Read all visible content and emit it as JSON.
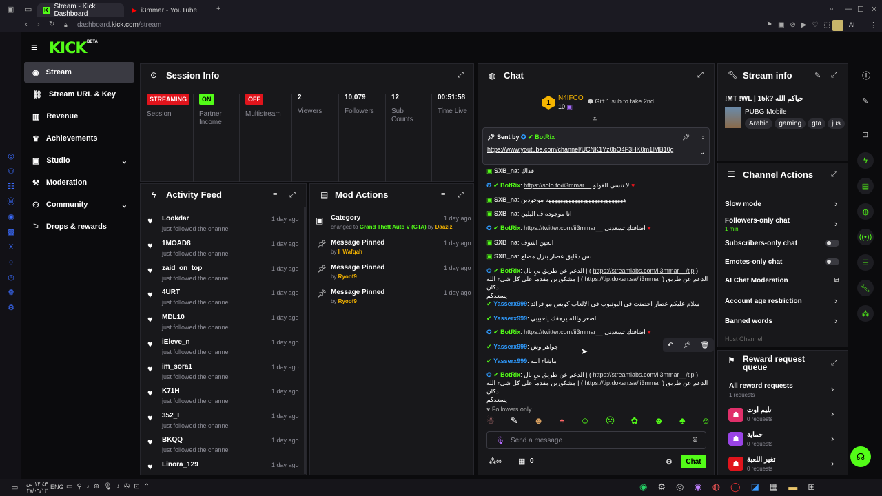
{
  "browser": {
    "tabs": [
      {
        "title": "Stream - Kick Dashboard",
        "active": true
      },
      {
        "title": "i3mmar - YouTube",
        "active": false
      }
    ],
    "url_prefix": "dashboard.",
    "url_main": "kick.com",
    "url_path": "/stream",
    "ai_label": "AI"
  },
  "brand": {
    "logo": "KICK",
    "beta": "BETA",
    "accent": "#53fc18"
  },
  "sidebar": {
    "items": [
      {
        "label": "Stream",
        "icon": "stream-icon",
        "active": true
      },
      {
        "label": "Stream URL & Key",
        "icon": "link-icon"
      },
      {
        "label": "Revenue",
        "icon": "chart-icon"
      },
      {
        "label": "Achievements",
        "icon": "trophy-icon"
      },
      {
        "label": "Studio",
        "icon": "video-icon",
        "expandable": true
      },
      {
        "label": "Moderation",
        "icon": "hammer-icon"
      },
      {
        "label": "Community",
        "icon": "users-icon",
        "expandable": true
      },
      {
        "label": "Drops & rewards",
        "icon": "gift-icon"
      }
    ]
  },
  "session": {
    "title": "Session Info",
    "stats": [
      {
        "badge": "STREAMING",
        "badge_color": "#e0141c",
        "label": "Session"
      },
      {
        "badge": "ON",
        "badge_color": "#53fc18",
        "label": "Partner Income"
      },
      {
        "badge": "OFF",
        "badge_color": "#e0141c",
        "label": "Multistream"
      },
      {
        "value": "2",
        "label": "Viewers"
      },
      {
        "value": "10,079",
        "label": "Followers"
      },
      {
        "value": "12",
        "label": "Sub Counts"
      },
      {
        "value": "00:51:58",
        "label": "Time Live"
      }
    ]
  },
  "activity": {
    "title": "Activity Feed",
    "subtitle": "just followed the channel",
    "time": "1 day ago",
    "items": [
      "Lookdar",
      "1MOAD8",
      "zaid_on_top",
      "4URT",
      "MDL10",
      "iEleve_n",
      "im_sora1",
      "K71H",
      "352_I",
      "BKQQ",
      "Linora_129"
    ]
  },
  "mod_actions": {
    "title": "Mod Actions",
    "time": "1 day ago",
    "items": [
      {
        "title": "Category",
        "desc_pre": "changed to ",
        "desc_green": "Grand Theft Auto V (GTA)",
        "desc_mid": " by ",
        "desc_user": "Daaziz"
      },
      {
        "title": "Message Pinned",
        "desc_pre": "by ",
        "desc_user": "I_Wafqah"
      },
      {
        "title": "Message Pinned",
        "desc_pre": "by ",
        "desc_user": "Ryoof9"
      },
      {
        "title": "Message Pinned",
        "desc_pre": "by ",
        "desc_user": "Ryoof9"
      }
    ]
  },
  "chat": {
    "title": "Chat",
    "top_gifter": {
      "name": "N4IFCO",
      "count": "10",
      "rank": "1"
    },
    "gift_text": "Gift 1 sub to take 2nd",
    "pinned": {
      "sent_by": "Sent by",
      "user": "BotRix",
      "link": "https://www.youtube.com/channel/UCNK1Yz0bO4F3HK0m1lMB10g"
    },
    "messages": [
      {
        "user": "SXB_na",
        "color": "#dcdcdc",
        "text": "فداك"
      },
      {
        "user": "BotRix",
        "color": "#53fc18",
        "link": "https://solo.to/ii3mmar__",
        "text": "لا تنسى الفولو"
      },
      {
        "user": "SXB_na",
        "color": "#dcdcdc",
        "text": "هههههههههههههههههههههههههههه موجودين"
      },
      {
        "user": "SXB_na",
        "color": "#dcdcdc",
        "text": "انا موجوده ف البلين"
      },
      {
        "user": "BotRix",
        "color": "#53fc18",
        "link": "https://twitter.com/ii3mmar__",
        "text": "اضافتك تسعدني"
      },
      {
        "user": "SXB_na",
        "color": "#dcdcdc",
        "text": "الحين اشوف"
      },
      {
        "user": "SXB_na",
        "color": "#dcdcdc",
        "text": "بس دقايق عصار بتزل مضلع"
      },
      {
        "user": "BotRix",
        "color": "#53fc18",
        "pre": "الدعم عن طريق بي بال | ( ",
        "link": "https://streamlabs.com/ii3mmar__/tip",
        "post": " )",
        "line2": "مشكورين مقدماً على كل شيء الله | ( ",
        "link2": "https://tip.dokan.sa/ii3mmar",
        "line3": " ) الدعم عن طريق دكان",
        "line4": "يسعدكم"
      },
      {
        "user": "Yasserx999",
        "color": "#2f9bff",
        "text": "سلام عليكم عصار احصنت في اليوتيوب في الالعاب كوبس مو قرائد"
      },
      {
        "user": "Yasserx999",
        "color": "#2f9bff",
        "text": "اصعر والله يرهقك ياحبيبي"
      },
      {
        "user": "BotRix",
        "color": "#53fc18",
        "link": "https://twitter.com/ii3mmar__",
        "text": "اضافتك تسعدني"
      },
      {
        "user": "Yasserx999",
        "color": "#2f9bff",
        "text": "جواهر وش"
      },
      {
        "user": "Yasserx999",
        "color": "#2f9bff",
        "text": "ماشاء الله"
      },
      {
        "user": "BotRix",
        "color": "#53fc18",
        "pre": "الدعم عن طريق بي بال | ( ",
        "link": "https://streamlabs.com/ii3mmar__/tip",
        "post": " )",
        "line2": "مشكورين مقدماً على كل شيء الله | ( ",
        "link2": "https://tip.dokan.sa/ii3mmar",
        "line3": " ) الدعم عن طريق دكان",
        "line4": "يسعدكم"
      }
    ],
    "followers_only": "Followers only",
    "input_placeholder": "Send a message",
    "points": "0",
    "send_label": "Chat"
  },
  "stream_info": {
    "title": "Stream info",
    "stream_title": "!MT !WL | 15k? حياكم الله",
    "category": "PUBG Mobile",
    "tags": [
      "Arabic",
      "gaming",
      "gta",
      "jus"
    ]
  },
  "channel_actions": {
    "title": "Channel Actions",
    "items": [
      {
        "label": "Slow mode",
        "kind": "chevron"
      },
      {
        "label": "Followers-only chat",
        "sub": "1 min",
        "kind": "chevron"
      },
      {
        "label": "Subscribers-only chat",
        "kind": "toggle"
      },
      {
        "label": "Emotes-only chat",
        "kind": "toggle"
      },
      {
        "label": "AI Chat Moderation",
        "kind": "external"
      },
      {
        "label": "Account age restriction",
        "kind": "chevron"
      },
      {
        "label": "Banned words",
        "kind": "chevron"
      }
    ],
    "host_label": "Host Channel"
  },
  "rewards": {
    "title": "Reward request queue",
    "items": [
      {
        "label": "All reward requests",
        "sub": "1 requests"
      },
      {
        "label": "تليم اوت",
        "sub": "0 requests"
      },
      {
        "label": "حماية",
        "sub": "0 requests"
      },
      {
        "label": "تغير اللعبة",
        "sub": "0 requests"
      }
    ]
  },
  "taskbar": {
    "time": "١٢:٤٣ ص",
    "date": "٢٧/٠٦/١٣",
    "lang": "ENG"
  }
}
